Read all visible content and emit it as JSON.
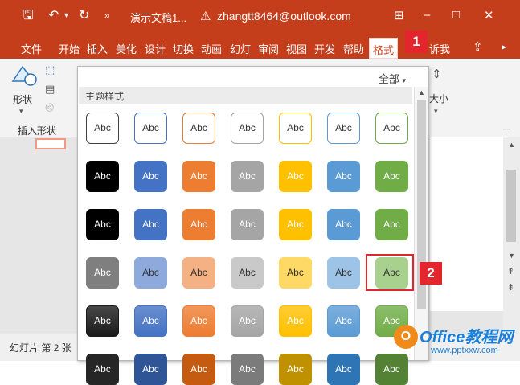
{
  "titlebar": {
    "title": "演示文稿1...",
    "account": "zhangtt8464@outlook.com",
    "icons": [
      "save-icon",
      "undo-icon",
      "redo-icon",
      "customize-icon",
      "warning-icon",
      "ribbon-display-icon",
      "minimize-icon",
      "maximize-icon",
      "close-icon"
    ]
  },
  "ribbon": {
    "tabs": [
      {
        "label": "文件",
        "active": false
      },
      {
        "label": "开始",
        "active": false
      },
      {
        "label": "插入",
        "active": false
      },
      {
        "label": "美化",
        "active": false
      },
      {
        "label": "设计",
        "active": false
      },
      {
        "label": "切换",
        "active": false
      },
      {
        "label": "动画",
        "active": false
      },
      {
        "label": "幻灯",
        "active": false
      },
      {
        "label": "审阅",
        "active": false
      },
      {
        "label": "视图",
        "active": false
      },
      {
        "label": "开发",
        "active": false
      },
      {
        "label": "帮助",
        "active": false
      },
      {
        "label": "格式",
        "active": true
      },
      {
        "label": "诉我",
        "active": false
      }
    ],
    "shape_button": "形状",
    "insert_shapes_group": "插入形状",
    "size_label": "大小"
  },
  "gallery": {
    "filter": "全部",
    "heading": "主题样式",
    "swatch_text": "Abc",
    "rows": [
      {
        "style": "outline",
        "colors": [
          "#404040",
          "#4472c4",
          "#ed7d31",
          "#a5a5a5",
          "#ffc000",
          "#5b9bd5",
          "#70ad47"
        ]
      },
      {
        "style": "solid",
        "colors": [
          "#000000",
          "#4472c4",
          "#ed7d31",
          "#a5a5a5",
          "#ffc000",
          "#5b9bd5",
          "#70ad47"
        ]
      },
      {
        "style": "solid",
        "colors": [
          "#000000",
          "#4472c4",
          "#ed7d31",
          "#a5a5a5",
          "#ffc000",
          "#5b9bd5",
          "#70ad47"
        ]
      },
      {
        "style": "light",
        "colors": [
          "#7f7f7f",
          "#8ea9db",
          "#f4b183",
          "#c9c9c9",
          "#ffd966",
          "#9dc3e6",
          "#a9d18e"
        ]
      },
      {
        "style": "gradient",
        "colors": [
          "#1a1a1a",
          "#4472c4",
          "#ed7d31",
          "#a5a5a5",
          "#ffc000",
          "#5b9bd5",
          "#70ad47"
        ]
      },
      {
        "style": "solid",
        "colors": [
          "#262626",
          "#2f5597",
          "#c55a11",
          "#7b7b7b",
          "#bf9000",
          "#2e75b6",
          "#548235"
        ]
      }
    ]
  },
  "callouts": {
    "step1": "1",
    "step2": "2"
  },
  "status": {
    "text": "幻灯片 第 2 张"
  },
  "watermark": {
    "logo": "O",
    "main": "Office教程网",
    "sub": "www.pptxxw.com"
  },
  "colors": {
    "accent": "#c43e1c",
    "callout": "#e3262e"
  }
}
